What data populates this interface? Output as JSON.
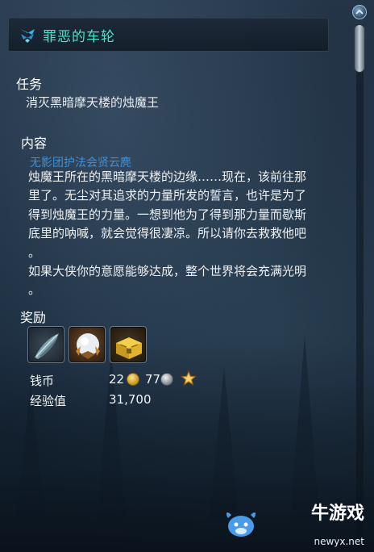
{
  "window": {
    "title": "罪恶的车轮"
  },
  "task": {
    "heading": "任务",
    "objective": "消灭黑暗摩天楼的烛魔王"
  },
  "content": {
    "heading": "内容",
    "quest_giver": "无影团护法会贤云麂",
    "lines": [
      "烛魔王所在的黑暗摩天楼的边缘……现在，该前往那",
      "里了。无尘对其追求的力量所发的誓言，也许是为了",
      "得到烛魔王的力量。一想到他为了得到那力量而歇斯",
      "底里的呐喊，就会觉得很凄凉。所以请你去救救他吧",
      "。",
      "如果大侠你的意愿能够达成，整个世界将会充满光明",
      "。"
    ]
  },
  "rewards": {
    "heading": "奖励",
    "items": [
      {
        "icon": "feather-blade-icon"
      },
      {
        "icon": "crystal-orb-icon"
      },
      {
        "icon": "treasure-chest-icon"
      }
    ],
    "money_label": "钱币",
    "money_gold": "22",
    "money_silver": "77",
    "exp_label": "经验值",
    "exp_value": "31,700"
  },
  "watermark": {
    "brand": "牛游戏",
    "url": "newyx.net"
  },
  "colors": {
    "title": "#4fe0c8",
    "quest_giver": "#3e8fd8",
    "text": "#eef1f3",
    "gold": "#e9c14a",
    "silver": "#b8bec6"
  }
}
